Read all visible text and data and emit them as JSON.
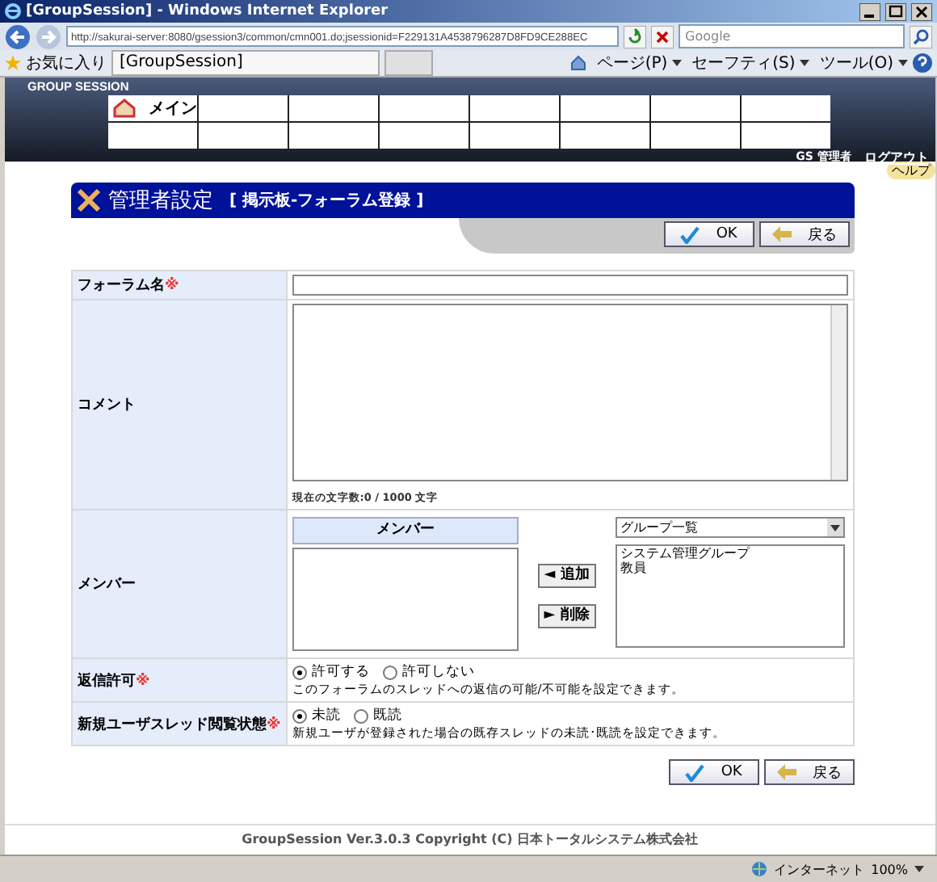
{
  "window": {
    "title": "[GroupSession] - Windows Internet Explorer"
  },
  "browser": {
    "address": "http://sakurai-server:8080/gsession3/common/cmn001.do;jsessionid=F229131A4538796287D8FD9CE288EC",
    "search_placeholder": "Google",
    "favorites": "お気に入り",
    "tab": "[GroupSession]",
    "menus": [
      "ページ(P)",
      "セーフティ(S)",
      "ツール(O)"
    ]
  },
  "app": {
    "brand": "GROUP SESSION",
    "nav": [
      {
        "label": "メイン"
      }
    ],
    "user": "GS  管理者",
    "logout": "ログアウト",
    "help": "ヘルプ"
  },
  "page": {
    "title": "管理者設定",
    "subtitle": "[ 掲示板-フォーラム登録 ]",
    "buttons": [
      "OK",
      "戻る"
    ]
  },
  "form": {
    "required_mark": "※",
    "forum_name": {
      "label": "フォーラム名",
      "required": true
    },
    "comment": {
      "label": "コメント",
      "required": false,
      "counter": "現在の文字数:0 / 1000 文字"
    },
    "members": {
      "label": "メンバー",
      "required": false,
      "list_header": "メンバー",
      "add": "◄ 追加",
      "remove": "► 削除",
      "group_select": "グループ一覧",
      "groups": [
        "システム管理グループ",
        "教員"
      ]
    },
    "reply": {
      "label": "返信許可",
      "required": true,
      "options": [
        {
          "label": "許可する",
          "selected": true
        },
        {
          "label": "許可しない",
          "selected": false
        }
      ],
      "note": "このフォーラムのスレッドへの返信の可能/不可能を設定できます。"
    },
    "read_state": {
      "label": "新規ユーザスレッド閲覧状態",
      "required": true,
      "options": [
        {
          "label": "未読",
          "selected": true
        },
        {
          "label": "既読",
          "selected": false
        }
      ],
      "note": "新規ユーザが登録された場合の既存スレッドの未読･既読を設定できます。"
    }
  },
  "bottom_buttons": [
    "OK",
    "戻る"
  ],
  "footer": "GroupSession Ver.3.0.3 Copyright (C) 日本トータルシステム株式会社",
  "status_bar": {
    "zone": "インターネット",
    "zoom": "100%"
  }
}
